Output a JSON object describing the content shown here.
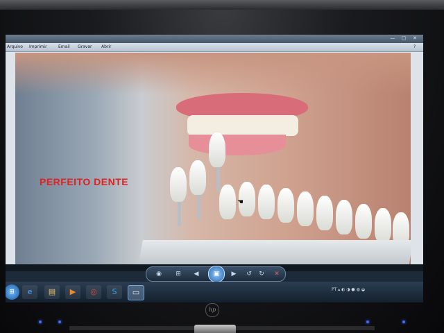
{
  "menubar": {
    "items": [
      "Arquivo",
      "Imprimir",
      "Email",
      "Gravar",
      "Abrir"
    ]
  },
  "photo": {
    "overlay_text": "PERFEITO DENTE"
  },
  "controls": {
    "icons": [
      "view-icon",
      "fit-icon",
      "previous-icon",
      "slideshow-play-icon",
      "next-icon",
      "rotate-left-icon",
      "rotate-right-icon",
      "delete-icon"
    ]
  },
  "taskbar": {
    "tray_lang": "PT",
    "colors": {
      "accent": "#2d6aa8",
      "overlay_text": "#e32020"
    }
  }
}
